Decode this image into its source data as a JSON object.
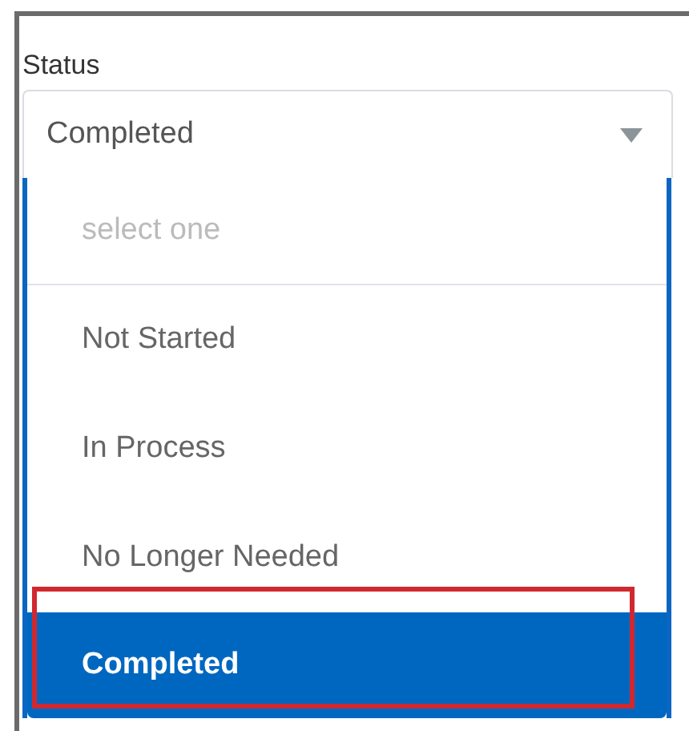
{
  "field": {
    "label": "Status",
    "value": "Completed"
  },
  "dropdown": {
    "placeholder": "select one",
    "options": [
      {
        "label": "Not Started",
        "selected": false
      },
      {
        "label": "In Process",
        "selected": false
      },
      {
        "label": "No Longer Needed",
        "selected": false
      },
      {
        "label": "Completed",
        "selected": true
      }
    ]
  }
}
